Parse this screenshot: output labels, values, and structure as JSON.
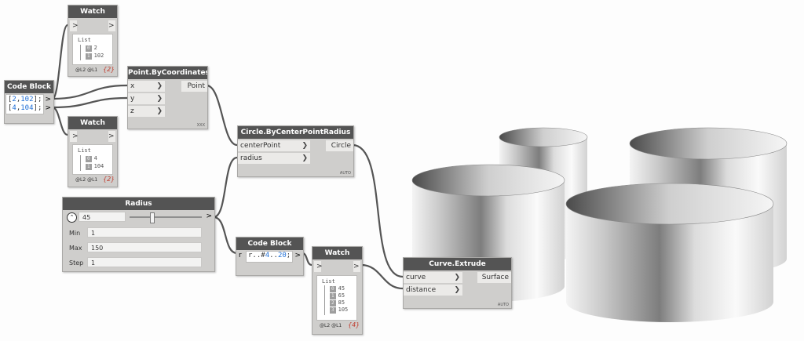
{
  "nodes": {
    "watch1": {
      "title": "Watch",
      "list_label": "List",
      "items": [
        {
          "index": "0",
          "value": "2"
        },
        {
          "index": "1",
          "value": "102"
        }
      ],
      "levels": "@L2 @L1",
      "count": "{2}"
    },
    "codeblock1": {
      "title": "Code Block",
      "lines": [
        [
          "[",
          "2",
          ",",
          "102",
          "];"
        ],
        [
          "[",
          "4",
          ",",
          "104",
          "];"
        ]
      ]
    },
    "point_by_coords": {
      "title": "Point.ByCoordinates",
      "inputs": [
        "x",
        "y",
        "z"
      ],
      "output": "Point",
      "lacing": "XXX"
    },
    "watch2": {
      "title": "Watch",
      "list_label": "List",
      "items": [
        {
          "index": "0",
          "value": "4"
        },
        {
          "index": "1",
          "value": "104"
        }
      ],
      "levels": "@L2 @L1",
      "count": "{2}"
    },
    "circle": {
      "title": "Circle.ByCenterPointRadius",
      "inputs": [
        "centerPoint",
        "radius"
      ],
      "output": "Circle",
      "lacing": "AUTO"
    },
    "radius": {
      "title": "Radius",
      "value": "45",
      "slider_fraction": 0.3,
      "min_label": "Min",
      "min": "1",
      "max_label": "Max",
      "max": "150",
      "step_label": "Step",
      "step": "1"
    },
    "codeblock2": {
      "title": "Code Block",
      "input": "r",
      "code_pre": "r..#",
      "code_num": "4",
      "code_mid": "..",
      "code_num2": "20",
      "code_end": ";"
    },
    "watch3": {
      "title": "Watch",
      "list_label": "List",
      "items": [
        {
          "index": "0",
          "value": "45"
        },
        {
          "index": "1",
          "value": "65"
        },
        {
          "index": "2",
          "value": "85"
        },
        {
          "index": "3",
          "value": "105"
        }
      ],
      "levels": "@L2 @L1",
      "count": "{4}"
    },
    "extrude": {
      "title": "Curve.Extrude",
      "inputs": [
        "curve",
        "distance"
      ],
      "output": "Surface",
      "lacing": "AUTO"
    }
  },
  "ports": {
    "in": ">",
    "out": ">"
  },
  "colors": {
    "header": "#545454",
    "node": "#cfcecc",
    "wire": "#555555",
    "number": "#1f6fd6"
  }
}
